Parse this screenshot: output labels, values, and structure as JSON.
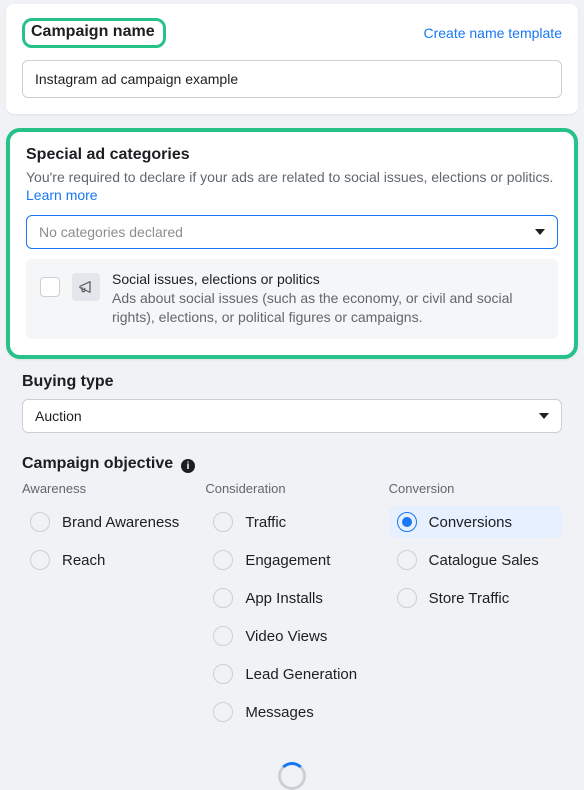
{
  "campaign_name": {
    "title": "Campaign name",
    "template_link": "Create name template",
    "value": "Instagram ad campaign example"
  },
  "special_categories": {
    "title": "Special ad categories",
    "subtext": "You're required to declare if your ads are related to social issues, elections or politics.",
    "learn_more": "Learn more",
    "select_placeholder": "No categories declared",
    "option": {
      "title": "Social issues, elections or politics",
      "desc": "Ads about social issues (such as the economy, or civil and social rights), elections, or political figures or campaigns."
    }
  },
  "buying_type": {
    "title": "Buying type",
    "value": "Auction"
  },
  "objective": {
    "title": "Campaign objective",
    "columns": [
      {
        "head": "Awareness",
        "items": [
          "Brand Awareness",
          "Reach"
        ]
      },
      {
        "head": "Consideration",
        "items": [
          "Traffic",
          "Engagement",
          "App Installs",
          "Video Views",
          "Lead Generation",
          "Messages"
        ]
      },
      {
        "head": "Conversion",
        "items": [
          "Conversions",
          "Catalogue Sales",
          "Store Traffic"
        ]
      }
    ],
    "selected": "Conversions"
  }
}
